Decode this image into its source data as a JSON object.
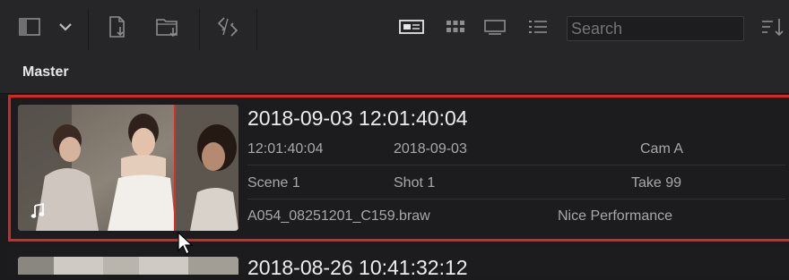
{
  "toolbar": {
    "search_placeholder": "Search",
    "icons": [
      "sidebar-toggle-icon",
      "chevron-down-icon",
      "import-media-icon",
      "import-folder-icon",
      "sync-icon",
      "metadata-view-icon",
      "thumbnail-view-icon",
      "filmstrip-view-icon",
      "list-view-icon",
      "sort-icon"
    ]
  },
  "bin": {
    "title": "Master"
  },
  "clips": [
    {
      "title": "2018-09-03  12:01:40:04",
      "timecode": "12:01:40:04",
      "date": "2018-09-03",
      "camera": "Cam A",
      "scene": "Scene 1",
      "shot": "Shot 1",
      "take": "Take 99",
      "filename": "A054_08251201_C159.braw",
      "comment": "Nice Performance",
      "has_audio": true,
      "selected": true
    },
    {
      "title": "2018-08-26  10:41:32:12",
      "selected": false
    }
  ],
  "colors": {
    "selection": "#d22a23",
    "background": "#1b1b1d",
    "toolbar": "#262628"
  }
}
